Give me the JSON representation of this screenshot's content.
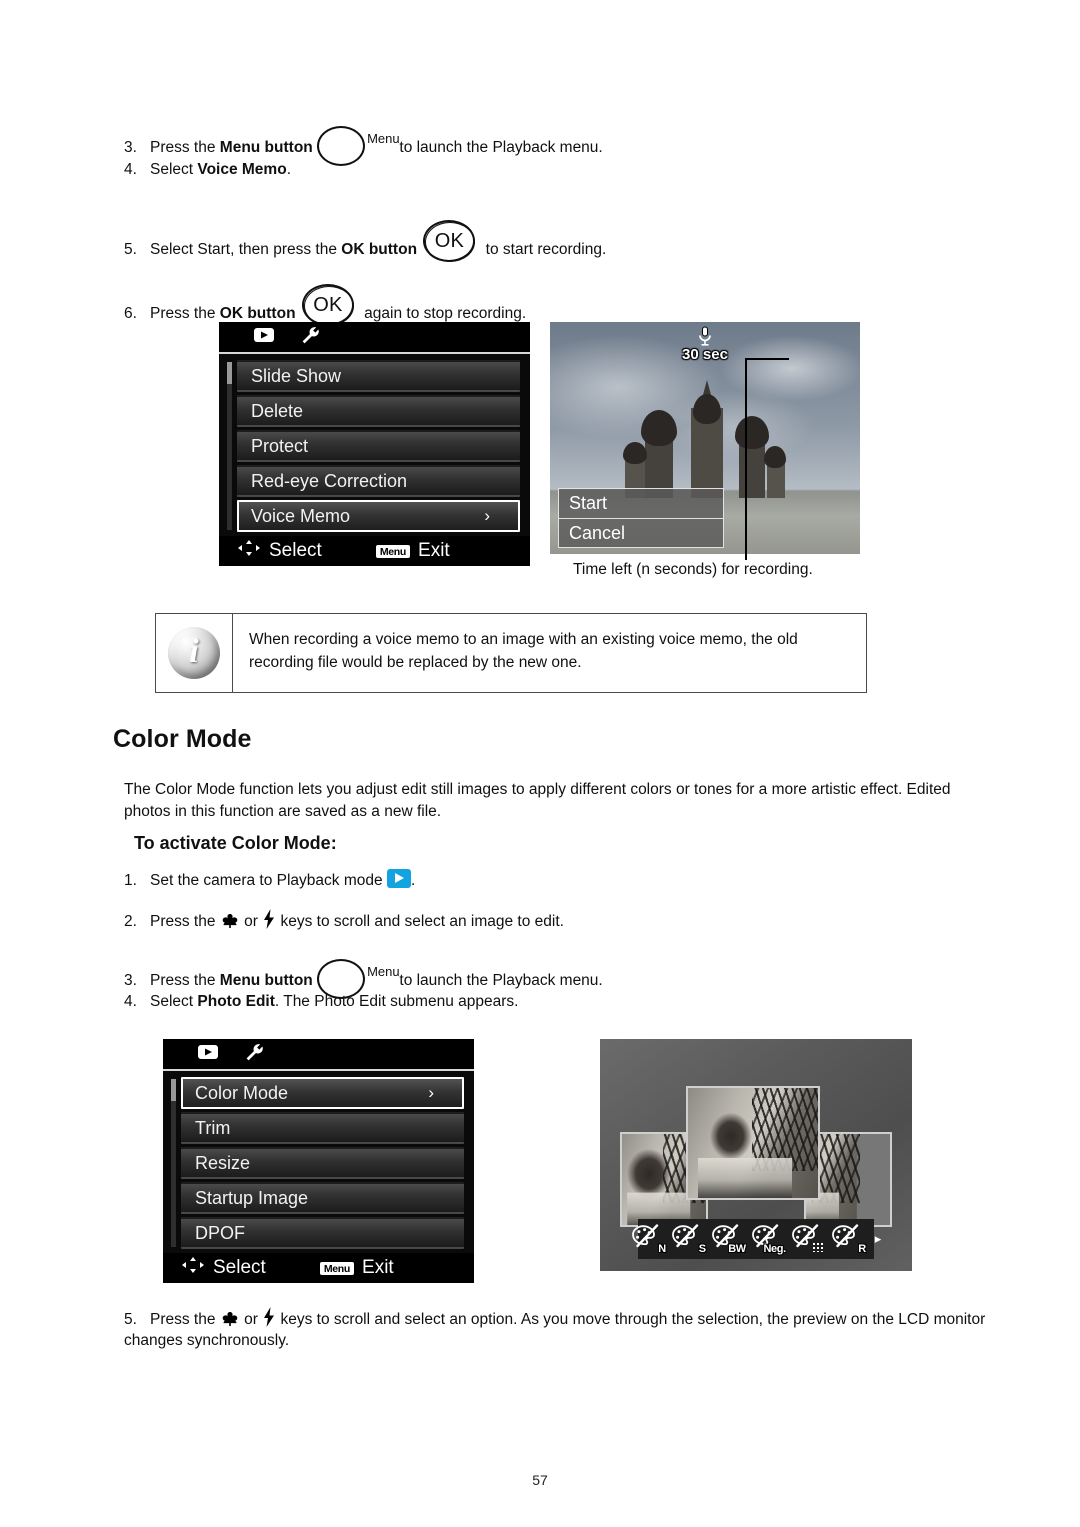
{
  "page": {
    "number": "57"
  },
  "voice_memo_steps": {
    "step3": {
      "num": "3.",
      "before": "Press the ",
      "bold": "Menu button",
      "button_label": "Menu",
      "after": " to launch the Playback menu."
    },
    "step4": {
      "num": "4.",
      "before": "Select ",
      "bold": "Voice Memo",
      "after": "."
    },
    "step5": {
      "num": "5.",
      "before": "Select Start, then press the ",
      "bold": "OK button",
      "button_label": "OK",
      "after": " to start recording."
    },
    "step6": {
      "num": "6.",
      "before": "Press the ",
      "bold": "OK button",
      "button_label": "OK",
      "after": " again to stop recording."
    }
  },
  "playback_menu": {
    "header_icons": [
      "playback-icon",
      "wrench-icon"
    ],
    "items": [
      {
        "label": "Slide Show",
        "selected": false,
        "chevron": ""
      },
      {
        "label": "Delete",
        "selected": false,
        "chevron": ""
      },
      {
        "label": "Protect",
        "selected": false,
        "chevron": ""
      },
      {
        "label": "Red-eye Correction",
        "selected": false,
        "chevron": ""
      },
      {
        "label": "Voice Memo",
        "selected": true,
        "chevron": "›"
      }
    ],
    "footer": {
      "select_label": "Select",
      "menu_badge": "Menu",
      "exit_label": "Exit"
    }
  },
  "voice_memo_preview": {
    "time_left": "30 sec",
    "mic_icon": "microphone-icon",
    "dialog_options": [
      "Start",
      "Cancel"
    ],
    "caption": "Time left (n seconds) for recording."
  },
  "note": {
    "icon": "info-icon",
    "icon_glyph": "i",
    "text": "When recording a voice memo to an image with an existing voice memo, the old recording file would be replaced by the new one."
  },
  "color_mode": {
    "heading": "Color Mode",
    "intro": "The Color Mode function lets you adjust edit still images to apply different colors or tones for a more artistic effect. Edited photos in this function are saved as a new file.",
    "subheading": "To activate Color Mode:",
    "steps": {
      "step1": {
        "num": "1.",
        "before": "Set the camera to Playback mode ",
        "icon": "playback-mode-icon",
        "after": "."
      },
      "step2": {
        "num": "2.",
        "before": "Press the ",
        "icon1": "macro-key-icon",
        "mid": " or ",
        "icon2": "flash-key-icon",
        "after": " keys to scroll and select an image to edit."
      },
      "step3": {
        "num": "3.",
        "before": "Press the ",
        "bold": "Menu button",
        "button_label": "Menu",
        "after": " to launch the Playback menu."
      },
      "step4": {
        "num": "4.",
        "before": "Select ",
        "bold": "Photo Edit",
        "after": ". The Photo Edit submenu appears."
      },
      "step5": {
        "num": "5.",
        "before": "Press the ",
        "icon1": "macro-key-icon",
        "mid": " or ",
        "icon2": "flash-key-icon",
        "after": " keys to scroll and select an option. As you move through the selection, the preview on the LCD monitor changes synchronously."
      }
    }
  },
  "photo_edit_menu": {
    "header_icons": [
      "playback-icon",
      "wrench-icon"
    ],
    "items": [
      {
        "label": "Color Mode",
        "selected": true,
        "chevron": "›"
      },
      {
        "label": "Trim",
        "selected": false,
        "chevron": ""
      },
      {
        "label": "Resize",
        "selected": false,
        "chevron": ""
      },
      {
        "label": "Startup Image",
        "selected": false,
        "chevron": ""
      },
      {
        "label": "DPOF",
        "selected": false,
        "chevron": ""
      }
    ],
    "footer": {
      "select_label": "Select",
      "menu_badge": "Menu",
      "exit_label": "Exit"
    }
  },
  "color_mode_preview": {
    "mode_icons": [
      {
        "tag": "N",
        "name": "color-mode-normal"
      },
      {
        "tag": "S",
        "name": "color-mode-sepia"
      },
      {
        "tag": "BW",
        "name": "color-mode-black-and-white"
      },
      {
        "tag": "Neg.",
        "name": "color-mode-negative"
      },
      {
        "tag": "",
        "name": "color-mode-mosaic"
      },
      {
        "tag": "R",
        "name": "color-mode-red"
      }
    ],
    "next_arrow": "▸"
  },
  "colors": {
    "playback_blue": "#13a3e0",
    "lcd_black": "#000000",
    "selected_border": "#ffffff"
  }
}
